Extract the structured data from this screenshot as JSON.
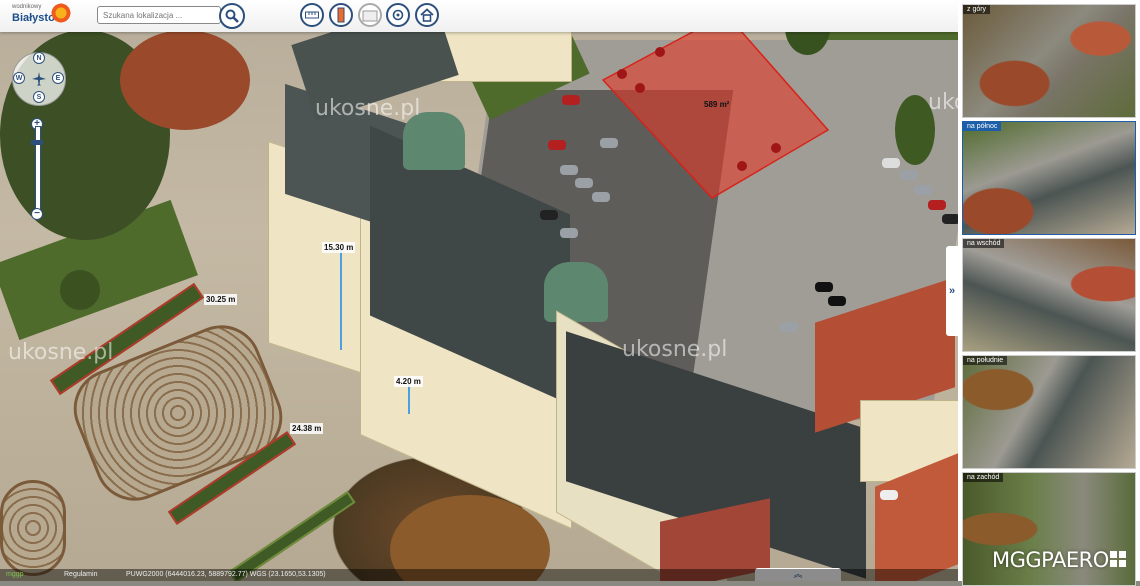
{
  "header": {
    "logo_small": "wodnikowy",
    "logo_city": "Białystok",
    "search_placeholder": "Szukana lokalizacja ..."
  },
  "toolbar": {
    "tools": [
      {
        "name": "measure-distance",
        "icon": "ruler-icon"
      },
      {
        "name": "measure-height",
        "icon": "height-icon"
      },
      {
        "name": "measure-area",
        "icon": "area-icon"
      },
      {
        "name": "zoom-view",
        "icon": "lens-icon"
      },
      {
        "name": "home",
        "icon": "home-icon"
      }
    ]
  },
  "navigation": {
    "compass": {
      "north": "N",
      "south": "S",
      "west": "W",
      "east": "E"
    },
    "zoom_in": "+",
    "zoom_out": "−"
  },
  "map": {
    "watermark": "ukosne.pl",
    "area_label": "589 m²",
    "measurements": [
      {
        "label": "15.30 m"
      },
      {
        "label": "30.25 m"
      },
      {
        "label": "4.20 m"
      },
      {
        "label": "24.38 m"
      }
    ]
  },
  "statusbar": {
    "item1": "mggp",
    "item2": "Regulamin",
    "item3": "PUWG2000 (6444016.23, 5889792.77) WGS (23.1650,53.1305)"
  },
  "side_toggle": "»",
  "expand_tab": "︽",
  "panel": {
    "views": [
      {
        "label": "z góry",
        "active": false
      },
      {
        "label": "na północ",
        "active": true
      },
      {
        "label": "na wschód",
        "active": false
      },
      {
        "label": "na południe",
        "active": false
      },
      {
        "label": "na zachód",
        "active": false
      }
    ]
  },
  "brand": "MGGPAERO",
  "colors": {
    "accent": "#2c4f7c",
    "area_fill": "#e03a2a",
    "active_view": "#1d5ea8"
  }
}
